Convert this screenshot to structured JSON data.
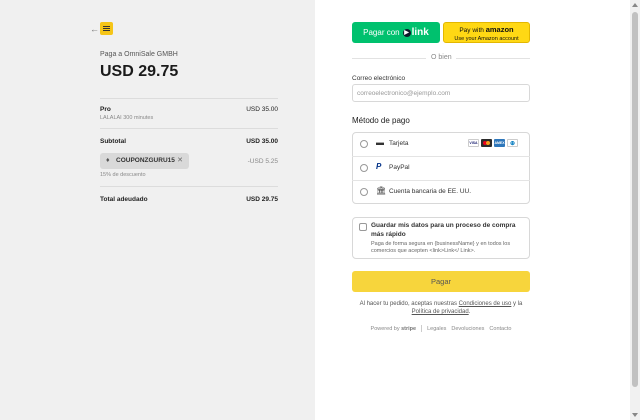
{
  "summary": {
    "pay_to": "Paga a OmniSale GMBH",
    "total": "USD 29.75",
    "item": {
      "name": "Pro",
      "description": "LALALAI 300 minutes",
      "price": "USD 35.00"
    },
    "subtotal_label": "Subtotal",
    "subtotal_value": "USD 35.00",
    "coupon": {
      "code": "COUPONZGURU15",
      "discount": "-USD 5.25",
      "note": "15% de descuento"
    },
    "total_due_label": "Total adeudado",
    "total_due_value": "USD 29.75"
  },
  "express": {
    "link_label": "Pagar con",
    "link_brand": "link",
    "amazon_line1_prefix": "Pay with",
    "amazon_brand": "amazon",
    "amazon_line2": "Use your Amazon account",
    "or_text": "O bien"
  },
  "email": {
    "label": "Correo electrónico",
    "placeholder": "correoelectronico@ejemplo.com"
  },
  "payment": {
    "title": "Método de pago",
    "methods": [
      {
        "label": "Tarjeta",
        "icon": "credit-card-icon"
      },
      {
        "label": "PayPal",
        "icon": "paypal-icon"
      },
      {
        "label": "Cuenta bancaria de EE. UU.",
        "icon": "bank-icon"
      }
    ],
    "card_brands": [
      "VISA",
      "mastercard",
      "amex",
      "diners"
    ]
  },
  "save": {
    "title": "Guardar mis datos para un proceso de compra más rápido",
    "description": "Paga de forma segura en {businessName} y en todos los comercios que acepten <link>Link</ Link>."
  },
  "pay_button": "Pagar",
  "terms": {
    "prefix": "Al hacer tu pedido, aceptas nuestras",
    "terms_link": "Condiciones de uso",
    "middle": "y la",
    "privacy_link": "Política de privacidad",
    "suffix": "."
  },
  "footer": {
    "powered_by": "Powered by",
    "stripe": "stripe",
    "links": [
      "Legales",
      "Devoluciones",
      "Contacto"
    ]
  },
  "colors": {
    "link_green": "#00c16e",
    "amazon_yellow": "#ffd814",
    "pay_button": "#f7d53c",
    "left_bg": "#f0f0f0"
  }
}
